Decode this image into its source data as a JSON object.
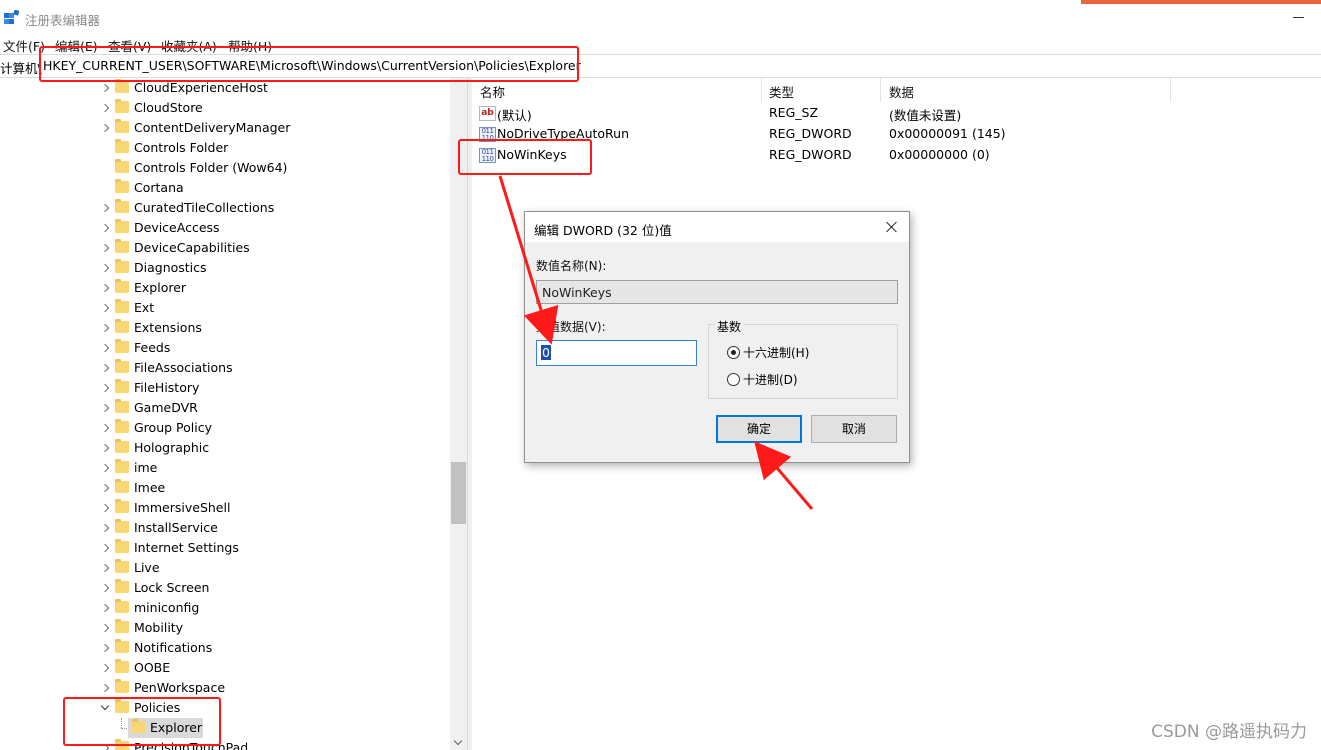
{
  "window": {
    "title": "注册表编辑器",
    "accent_color": "#e5683a"
  },
  "menu": [
    {
      "label": "文件(F)"
    },
    {
      "label": "编辑(E)"
    },
    {
      "label": "查看(V)"
    },
    {
      "label": "收藏夹(A)"
    },
    {
      "label": "帮助(H)"
    }
  ],
  "address": {
    "root": "计算机\\",
    "path": "HKEY_CURRENT_USER\\SOFTWARE\\Microsoft\\Windows\\CurrentVersion\\Policies\\Explorer"
  },
  "tree": {
    "items": [
      {
        "label": "CloudExperienceHost",
        "expand": "collapsed"
      },
      {
        "label": "CloudStore",
        "expand": "collapsed"
      },
      {
        "label": "ContentDeliveryManager",
        "expand": "collapsed"
      },
      {
        "label": "Controls Folder",
        "expand": "none"
      },
      {
        "label": "Controls Folder (Wow64)",
        "expand": "none"
      },
      {
        "label": "Cortana",
        "expand": "none"
      },
      {
        "label": "CuratedTileCollections",
        "expand": "collapsed"
      },
      {
        "label": "DeviceAccess",
        "expand": "collapsed"
      },
      {
        "label": "DeviceCapabilities",
        "expand": "collapsed"
      },
      {
        "label": "Diagnostics",
        "expand": "collapsed"
      },
      {
        "label": "Explorer",
        "expand": "collapsed"
      },
      {
        "label": "Ext",
        "expand": "collapsed"
      },
      {
        "label": "Extensions",
        "expand": "collapsed"
      },
      {
        "label": "Feeds",
        "expand": "collapsed"
      },
      {
        "label": "FileAssociations",
        "expand": "collapsed"
      },
      {
        "label": "FileHistory",
        "expand": "collapsed"
      },
      {
        "label": "GameDVR",
        "expand": "collapsed"
      },
      {
        "label": "Group Policy",
        "expand": "collapsed"
      },
      {
        "label": "Holographic",
        "expand": "collapsed"
      },
      {
        "label": "ime",
        "expand": "collapsed"
      },
      {
        "label": "Imee",
        "expand": "collapsed"
      },
      {
        "label": "ImmersiveShell",
        "expand": "collapsed"
      },
      {
        "label": "InstallService",
        "expand": "collapsed"
      },
      {
        "label": "Internet Settings",
        "expand": "collapsed"
      },
      {
        "label": "Live",
        "expand": "collapsed"
      },
      {
        "label": "Lock Screen",
        "expand": "collapsed"
      },
      {
        "label": "miniconfig",
        "expand": "collapsed"
      },
      {
        "label": "Mobility",
        "expand": "collapsed"
      },
      {
        "label": "Notifications",
        "expand": "collapsed"
      },
      {
        "label": "OOBE",
        "expand": "collapsed"
      },
      {
        "label": "PenWorkspace",
        "expand": "collapsed"
      },
      {
        "label": "Policies",
        "expand": "expanded"
      },
      {
        "label": "PrecisionTouchPad",
        "expand": "collapsed"
      }
    ],
    "selected_child": {
      "label": "Explorer"
    }
  },
  "list": {
    "columns": [
      "名称",
      "类型",
      "数据"
    ],
    "rows": [
      {
        "icon": "string-value-icon",
        "name": "(默认)",
        "type": "REG_SZ",
        "data": "(数值未设置)"
      },
      {
        "icon": "binary-value-icon",
        "name": "NoDriveTypeAutoRun",
        "type": "REG_DWORD",
        "data": "0x00000091 (145)"
      },
      {
        "icon": "binary-value-icon",
        "name": "NoWinKeys",
        "type": "REG_DWORD",
        "data": "0x00000000 (0)"
      }
    ]
  },
  "dialog": {
    "title": "编辑 DWORD (32 位)值",
    "value_name_label": "数值名称(N):",
    "value_name": "NoWinKeys",
    "value_data_label": "数值数据(V):",
    "value_data": "0",
    "base_label": "基数",
    "radio_hex": "十六进制(H)",
    "radio_dec": "十进制(D)",
    "selected_base": "hex",
    "ok": "确定",
    "cancel": "取消"
  },
  "watermark": "CSDN @路遥执码力",
  "annotation_color": "#ff1a1a"
}
